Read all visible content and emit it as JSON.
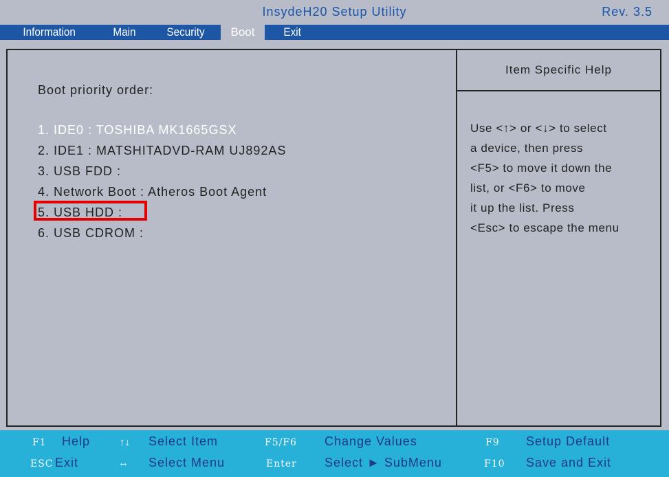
{
  "title_bar": {
    "title": "InsydeH20 Setup Utility",
    "revision": "Rev. 3.5"
  },
  "menu": {
    "items": [
      {
        "label": "Information",
        "active": false
      },
      {
        "label": "Main",
        "active": false
      },
      {
        "label": "Security",
        "active": false
      },
      {
        "label": "Boot",
        "active": true
      },
      {
        "label": "Exit",
        "active": false
      }
    ]
  },
  "main": {
    "boot_priority_label": "Boot priority order:",
    "boot_items": [
      {
        "label": "1. IDE0 : TOSHIBA MK1665GSX",
        "selected": true
      },
      {
        "label": "2. IDE1 : MATSHITADVD-RAM UJ892AS",
        "selected": false
      },
      {
        "label": "3. USB FDD :",
        "selected": false
      },
      {
        "label": "4. Network Boot : Atheros Boot Agent",
        "selected": false
      },
      {
        "label": "5. USB HDD :",
        "selected": false
      },
      {
        "label": "6. USB CDROM :",
        "selected": false
      }
    ]
  },
  "help_panel": {
    "title": "Item Specific Help",
    "lines": [
      "Use <↑> or <↓> to select",
      "a device, then press",
      "<F5> to move it down the",
      "list, or <F6> to move",
      "it up the list. Press",
      "<Esc> to escape the menu"
    ]
  },
  "footer": {
    "f1_key": "F1",
    "f1_desc": "Help",
    "esc_key": "ESC",
    "esc_desc": "Exit",
    "updown_arrows": "↑↓",
    "select_item": "Select  Item",
    "leftright_arrows": "↔",
    "select_menu": "Select  Menu",
    "f5f6_key": "F5/F6",
    "change_values": "Change  Values",
    "enter_key": "Enter",
    "select_submenu": "Select  ► SubMenu",
    "f9_key": "F9",
    "setup_default": "Setup  Default",
    "f10_key": "F10",
    "save_exit": "Save  and  Exit"
  },
  "colors": {
    "menu_bar": "#1e56a6",
    "panel_bg": "#b8bcc8",
    "footer_bg": "#27b0d8",
    "highlight_box": "#e20000"
  }
}
